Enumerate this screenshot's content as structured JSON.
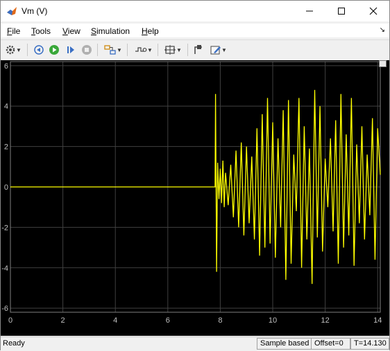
{
  "window": {
    "title": "Vm (V)"
  },
  "menu": [
    {
      "label": "File",
      "mnemonic": "F",
      "rest": "ile"
    },
    {
      "label": "Tools",
      "mnemonic": "T",
      "rest": "ools"
    },
    {
      "label": "View",
      "mnemonic": "V",
      "rest": "iew"
    },
    {
      "label": "Simulation",
      "mnemonic": "S",
      "rest": "imulation"
    },
    {
      "label": "Help",
      "mnemonic": "H",
      "rest": "elp"
    }
  ],
  "toolbar": {
    "icons": [
      "settings-icon",
      "step-back-icon",
      "run-icon",
      "step-forward-icon",
      "stop-icon",
      "highlight-icon",
      "triggers-icon",
      "zoom-fit-icon",
      "cursor-measure-icon",
      "style-icon"
    ]
  },
  "status": {
    "ready": "Ready",
    "sample_mode": "Sample based",
    "offset": "Offset=0",
    "time": "T=14.130"
  },
  "colors": {
    "plot_bg": "#000000",
    "trace": "#ffff00",
    "grid": "#404040",
    "axis_text": "#c0c0c0"
  },
  "chart_data": {
    "type": "line",
    "title": "",
    "xlabel": "",
    "ylabel": "",
    "xlim": [
      0,
      14.1
    ],
    "ylim": [
      -6.2,
      6.2
    ],
    "xticks": [
      0,
      2,
      4,
      6,
      8,
      10,
      12,
      14
    ],
    "yticks": [
      -6,
      -4,
      -2,
      0,
      2,
      4,
      6
    ],
    "grid": true,
    "series": [
      {
        "x": [
          0,
          7.8,
          7.82,
          7.86,
          7.9,
          7.95,
          8.0,
          8.05,
          8.1,
          8.15,
          8.2,
          8.3,
          8.4,
          8.5,
          8.6,
          8.7,
          8.8,
          8.9,
          9.0,
          9.1,
          9.2,
          9.3,
          9.4,
          9.5,
          9.6,
          9.7,
          9.8,
          9.9,
          10.0,
          10.1,
          10.2,
          10.3,
          10.4,
          10.5,
          10.6,
          10.7,
          10.8,
          10.9,
          11.0,
          11.1,
          11.2,
          11.3,
          11.4,
          11.5,
          11.6,
          11.7,
          11.8,
          11.9,
          12.0,
          12.1,
          12.2,
          12.3,
          12.4,
          12.5,
          12.6,
          12.7,
          12.8,
          12.9,
          13.0,
          13.1,
          13.2,
          13.3,
          13.4,
          13.5,
          13.6,
          13.7,
          13.8,
          13.9,
          14.0,
          14.1
        ],
        "values": [
          0,
          0,
          4.6,
          -4.2,
          1.2,
          -0.6,
          0.9,
          -0.8,
          1.3,
          -1.0,
          0.7,
          -0.9,
          1.1,
          -1.5,
          1.8,
          -2.0,
          2.2,
          -2.4,
          2.0,
          -1.8,
          1.5,
          -2.6,
          2.9,
          -3.4,
          3.6,
          -3.0,
          4.4,
          -2.8,
          3.2,
          -3.5,
          2.4,
          -2.0,
          3.8,
          -4.6,
          4.3,
          -3.8,
          1.6,
          -1.2,
          4.4,
          -4.0,
          3.0,
          -2.6,
          1.9,
          -4.8,
          4.8,
          -2.5,
          4.0,
          -3.2,
          1.4,
          -1.0,
          2.4,
          -2.2,
          3.3,
          -3.8,
          4.6,
          -3.0,
          2.6,
          -2.4,
          4.4,
          -3.9,
          2.1,
          -1.8,
          3.0,
          -2.6,
          1.6,
          -1.4,
          3.4,
          -3.6,
          2.9,
          0.6
        ]
      }
    ]
  }
}
